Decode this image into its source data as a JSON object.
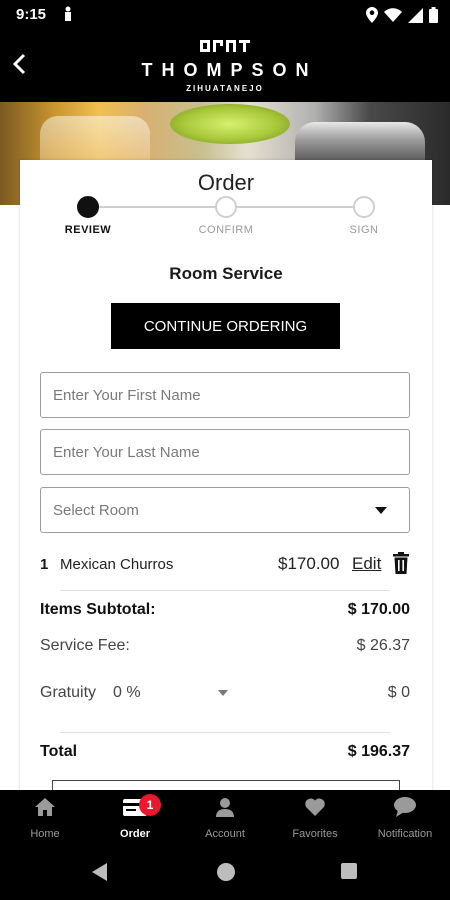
{
  "status_bar": {
    "time": "9:15"
  },
  "header": {
    "brand": "THOMPSON",
    "subtitle": "ZIHUATANEJO"
  },
  "order": {
    "title": "Order",
    "steps": [
      {
        "label": "REVIEW",
        "active": true
      },
      {
        "label": "CONFIRM",
        "active": false
      },
      {
        "label": "SIGN",
        "active": false
      }
    ],
    "service_type": "Room Service",
    "continue_label": "CONTINUE ORDERING",
    "first_name_placeholder": "Enter Your First Name",
    "last_name_placeholder": "Enter Your Last Name",
    "room_select": "Select Room",
    "items": [
      {
        "qty": "1",
        "name": "Mexican Churros",
        "price": "$170.00",
        "edit_label": "Edit"
      }
    ],
    "subtotal_label": "Items Subtotal:",
    "subtotal_value": "$ 170.00",
    "service_fee_label": "Service Fee:",
    "service_fee_value": "$ 26.37",
    "gratuity_label": "Gratuity",
    "gratuity_percent": "0 %",
    "gratuity_value": "$ 0",
    "total_label": "Total",
    "total_value": "$ 196.37"
  },
  "tabs": [
    {
      "label": "Home",
      "icon": "home-icon"
    },
    {
      "label": "Order",
      "icon": "order-icon",
      "badge": "1"
    },
    {
      "label": "Account",
      "icon": "person-icon"
    },
    {
      "label": "Favorites",
      "icon": "heart-icon"
    },
    {
      "label": "Notification",
      "icon": "chat-bubble-icon"
    }
  ],
  "colors": {
    "badge": "#e8192c",
    "primary": "#000000"
  }
}
